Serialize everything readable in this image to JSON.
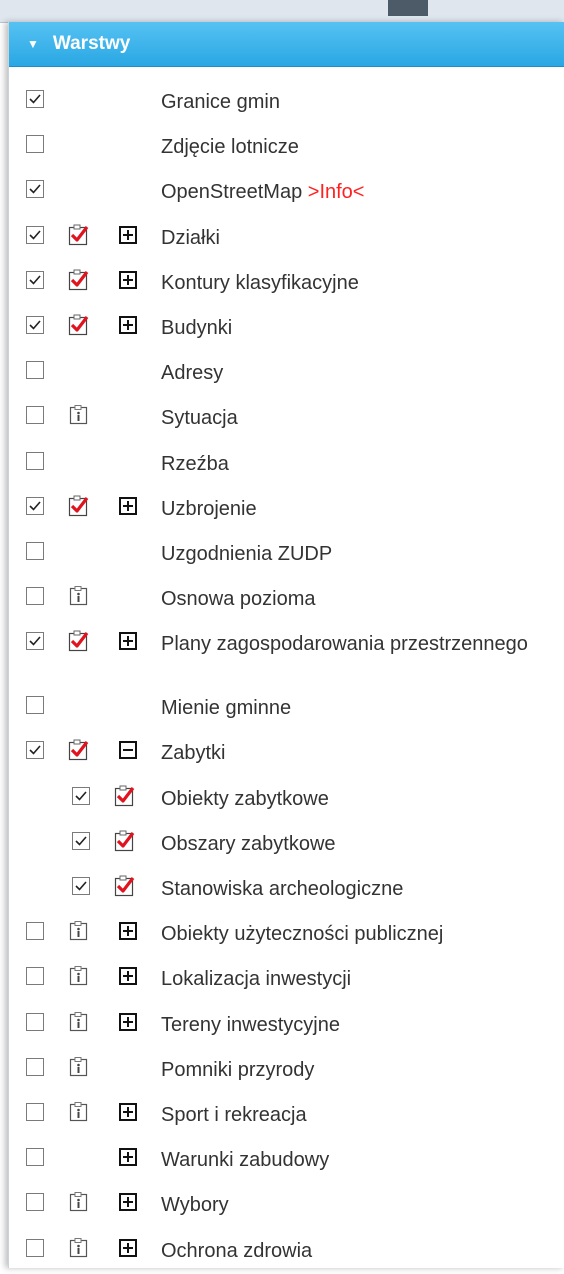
{
  "header": {
    "title": "Warstwy",
    "arrow_icon": "triangle-down-icon"
  },
  "layers": [
    {
      "label": "Granice gmin",
      "checked": true,
      "legend": "none",
      "expander": "none",
      "indent": 0
    },
    {
      "label": "Zdjęcie lotnicze",
      "checked": false,
      "legend": "none",
      "expander": "none",
      "indent": 0
    },
    {
      "label": "OpenStreetMap",
      "info": ">Info<",
      "checked": true,
      "legend": "none",
      "expander": "none",
      "indent": 0
    },
    {
      "label": "Działki",
      "checked": true,
      "legend": "red-check",
      "expander": "plus",
      "indent": 0
    },
    {
      "label": "Kontury klasyfikacyjne",
      "checked": true,
      "legend": "red-check",
      "expander": "plus",
      "indent": 0
    },
    {
      "label": "Budynki",
      "checked": true,
      "legend": "red-check",
      "expander": "plus",
      "indent": 0
    },
    {
      "label": "Adresy",
      "checked": false,
      "legend": "none",
      "expander": "none",
      "indent": 0
    },
    {
      "label": "Sytuacja",
      "checked": false,
      "legend": "info",
      "expander": "none",
      "indent": 0
    },
    {
      "label": "Rzeźba",
      "checked": false,
      "legend": "none",
      "expander": "none",
      "indent": 0
    },
    {
      "label": "Uzbrojenie",
      "checked": true,
      "legend": "red-check",
      "expander": "plus",
      "indent": 0
    },
    {
      "label": "Uzgodnienia ZUDP",
      "checked": false,
      "legend": "none",
      "expander": "none",
      "indent": 0
    },
    {
      "label": "Osnowa pozioma",
      "checked": false,
      "legend": "info",
      "expander": "none",
      "indent": 0
    },
    {
      "label": "Plany zagospodarowania przestrzennego",
      "checked": true,
      "legend": "red-check",
      "expander": "plus",
      "indent": 0,
      "tall": true
    },
    {
      "label": "Mienie gminne",
      "checked": false,
      "legend": "none",
      "expander": "none",
      "indent": 0
    },
    {
      "label": "Zabytki",
      "checked": true,
      "legend": "red-check",
      "expander": "minus",
      "indent": 0
    },
    {
      "label": "Obiekty zabytkowe",
      "checked": true,
      "legend": "red-check",
      "expander": "none",
      "indent": 1
    },
    {
      "label": "Obszary zabytkowe",
      "checked": true,
      "legend": "red-check",
      "expander": "none",
      "indent": 1
    },
    {
      "label": "Stanowiska archeologiczne",
      "checked": true,
      "legend": "red-check",
      "expander": "none",
      "indent": 1
    },
    {
      "label": "Obiekty użyteczności publicznej",
      "checked": false,
      "legend": "info",
      "expander": "plus",
      "indent": 0
    },
    {
      "label": "Lokalizacja inwestycji",
      "checked": false,
      "legend": "info",
      "expander": "plus",
      "indent": 0
    },
    {
      "label": "Tereny inwestycyjne",
      "checked": false,
      "legend": "info",
      "expander": "plus",
      "indent": 0
    },
    {
      "label": "Pomniki przyrody",
      "checked": false,
      "legend": "info",
      "expander": "none",
      "indent": 0
    },
    {
      "label": "Sport i rekreacja",
      "checked": false,
      "legend": "info",
      "expander": "plus",
      "indent": 0
    },
    {
      "label": "Warunki zabudowy",
      "checked": false,
      "legend": "none",
      "expander": "plus",
      "indent": 0
    },
    {
      "label": "Wybory",
      "checked": false,
      "legend": "info",
      "expander": "plus",
      "indent": 0
    },
    {
      "label": "Ochrona zdrowia",
      "checked": false,
      "legend": "info",
      "expander": "plus",
      "indent": 0
    }
  ],
  "colors": {
    "header": "#2aa7e4",
    "info_link": "#ff2020",
    "check_red": "#e0141e"
  }
}
